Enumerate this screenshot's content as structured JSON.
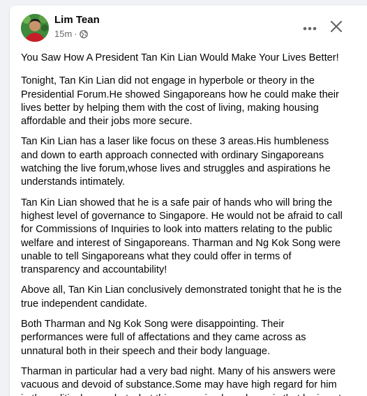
{
  "post": {
    "author": "Lim Tean",
    "time": "15m",
    "separator": "·",
    "paragraphs": [
      "You Saw How A President Tan Kin Lian Would Make Your Lives Better!",
      "Tonight, Tan Kin Lian did not engage in hyperbole or theory in the Presidential Forum.He showed Singaporeans how he could make their lives better by helping them with the cost of living, making housing affordable and their jobs more secure.",
      "Tan Kin Lian has a laser like focus on these 3 areas.His humbleness and down to earth approach connected with ordinary Singaporeans watching the live forum,whose lives and struggles and aspirations he understands intimately.",
      "Tan Kin Lian showed that he is a safe pair of hands who will bring the highest level of governance to Singapore. He would not be afraid to call for Commissions of Inquiries to look into matters relating to the public welfare and interest of Singaporeans. Tharman and Ng Kok Song were unable to tell Singaporeans what they could offer in terms of transparency and accountability!",
      "Above all, Tan Kin Lian conclusively demonstrated tonight that he is the true independent candidate.",
      "Both Tharman and Ng Kok Song were disappointing. Their performances were full of affectations and they came across as unnatural both in their speech and their body language.",
      "Tharman in particular had a very bad night. Many of his answers were vacuous and devoid of substance.Some may have high regard for him in the political arena,but what this campaign has shown is that he is not"
    ]
  },
  "icons": {
    "avatar": "profile-photo",
    "audience": "globe-icon",
    "more": "more-horizontal-icon",
    "close": "close-icon"
  },
  "colors": {
    "background": "#f0f2f5",
    "card": "#ffffff",
    "text": "#050505",
    "secondary_text": "#65676b"
  }
}
